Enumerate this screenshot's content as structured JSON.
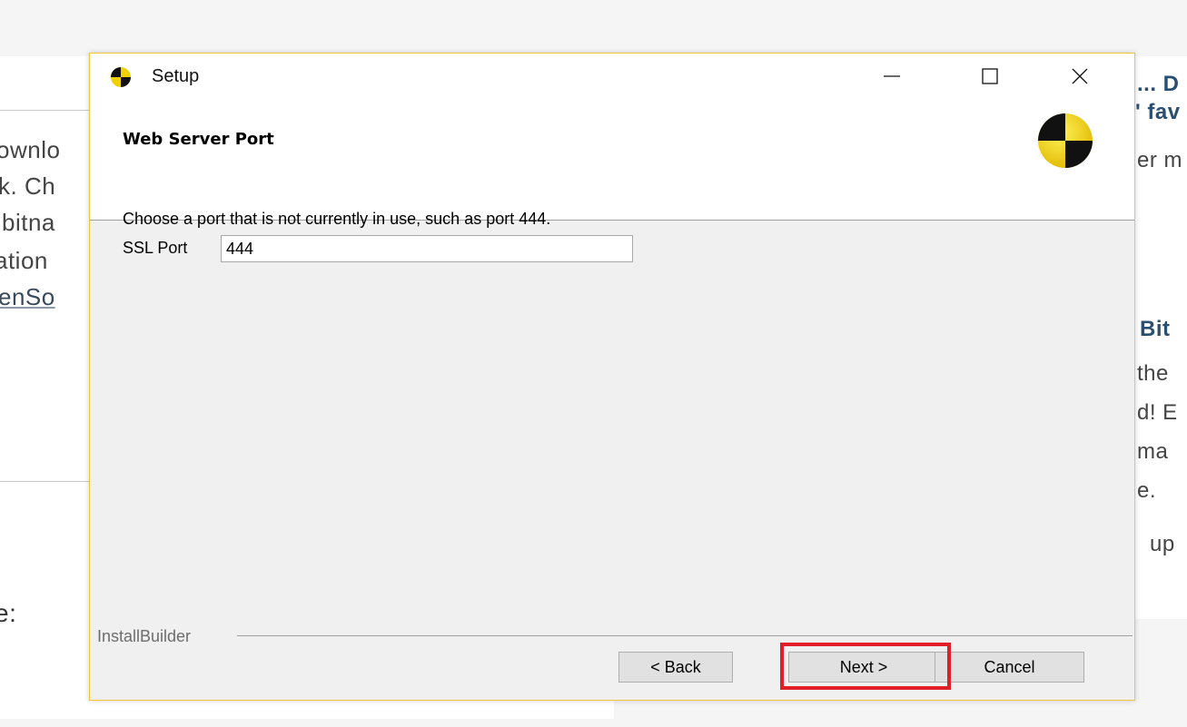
{
  "background_page": {
    "left_fragments": [
      "ownlo",
      "k. Ch",
      "bitna",
      "ation",
      "enSo",
      "e:"
    ],
    "right_fragments": [
      "... D",
      "' fav",
      "er m",
      "Bit",
      "the",
      "d! E",
      "ma",
      "e.",
      "up"
    ]
  },
  "dialog": {
    "title": "Setup",
    "header_title": "Web Server Port",
    "instruction": "Choose a port that is not currently in use, such as port 444.",
    "port_label": "SSL Port",
    "port_value": "444",
    "brand": "InstallBuilder",
    "buttons": {
      "back": "< Back",
      "next": "Next >",
      "cancel": "Cancel"
    }
  },
  "icons": {
    "app": "installer-logo-icon",
    "minimize": "minimize-icon",
    "maximize": "maximize-icon",
    "close": "close-icon"
  },
  "colors": {
    "dialog_border": "#f3c53a",
    "logo_yellow": "#f0d000",
    "highlight": "#e21f26"
  }
}
